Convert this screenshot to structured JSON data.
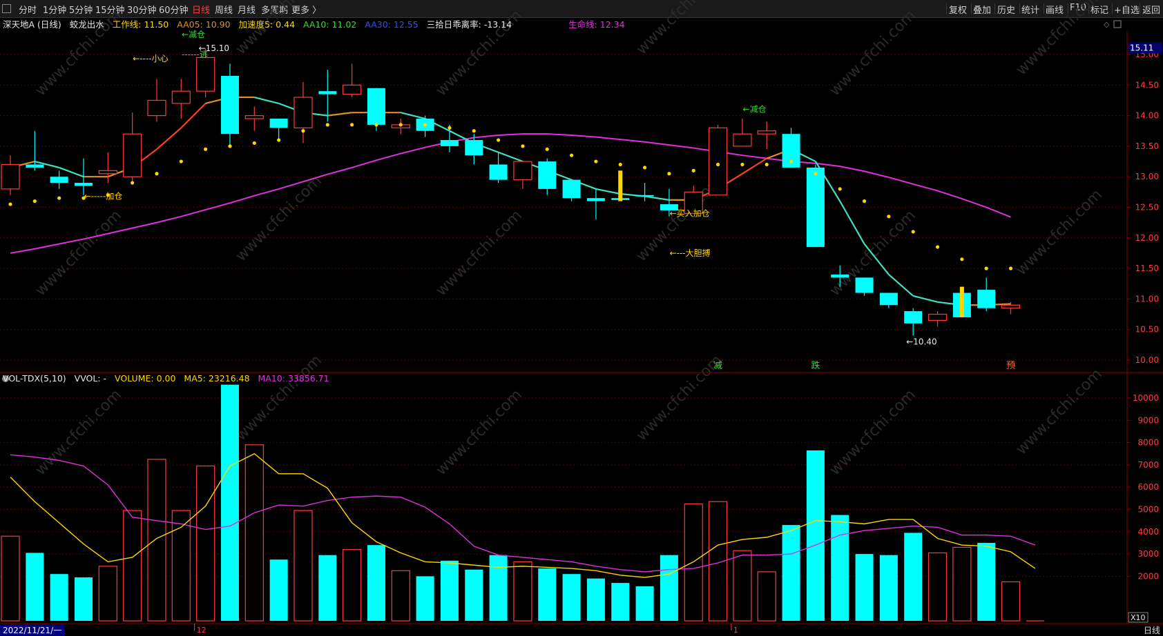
{
  "toolbar": {
    "left_items": [
      "分时",
      "1分钟",
      "5分钟",
      "15分钟",
      "30分钟",
      "60分钟",
      "日线",
      "周线",
      "月线",
      "多周期",
      "更多 〉"
    ],
    "active": "日线",
    "right_items": [
      "复权",
      "叠加",
      "历史",
      "统计",
      "画线",
      "F10",
      "标记",
      "+自选",
      "返回"
    ]
  },
  "main_info": {
    "stock": "深天地A (日线)",
    "indicator": "蛟龙出水",
    "work_line": "工作线: 11.50",
    "aa05": "AA05: 10.90",
    "speed": "加速度5: 0.44",
    "aa10": "AA10: 11.02",
    "aa30": "AA30: 12.55",
    "deviation": "三拾日乖离率: -13.14",
    "life_line": "生命线: 12.34"
  },
  "vol_info": {
    "name": "VOL-TDX(5,10)",
    "vvol": "VVOL: -",
    "volume": "VOLUME: 0.00",
    "ma5": "MA5: 23216.48",
    "ma10": "MA10: 33856.71"
  },
  "footer": {
    "date": "2022/11/21/一",
    "period": "日线",
    "month_labels": [
      "12",
      "1"
    ]
  },
  "watermark": "www.cfchi.com",
  "colors": {
    "up": "#ff3b3b",
    "down": "#00ffff",
    "yellow": "#ffd700",
    "magenta": "#e030e0",
    "green": "#33dd33",
    "cyan_line": "#40e0c0",
    "orange": "#e09020"
  },
  "chart_data": [
    {
      "type": "candlestick",
      "title": "深天地A (日线)",
      "y_ticks": [
        10.0,
        10.5,
        11.0,
        11.5,
        12.0,
        12.5,
        13.0,
        13.5,
        14.0,
        14.5,
        15.0
      ],
      "ylim": [
        9.5,
        15.2
      ],
      "current_price_tag": "15.11",
      "candles": [
        {
          "o": 12.8,
          "c": 13.2,
          "h": 13.35,
          "l": 12.7,
          "u": 1
        },
        {
          "o": 13.2,
          "c": 13.15,
          "h": 13.75,
          "l": 13.1,
          "u": 0
        },
        {
          "o": 13.0,
          "c": 12.9,
          "h": 13.1,
          "l": 12.8,
          "u": 0
        },
        {
          "o": 12.9,
          "c": 12.85,
          "h": 13.3,
          "l": 12.7,
          "u": 0
        },
        {
          "o": 13.05,
          "c": 13.1,
          "h": 13.4,
          "l": 12.9,
          "u": 1
        },
        {
          "o": 13.0,
          "c": 13.7,
          "h": 14.05,
          "l": 12.9,
          "u": 1
        },
        {
          "o": 14.0,
          "c": 14.25,
          "h": 14.6,
          "l": 13.9,
          "u": 1
        },
        {
          "o": 14.2,
          "c": 14.4,
          "h": 14.6,
          "l": 13.95,
          "u": 1
        },
        {
          "o": 14.4,
          "c": 14.95,
          "h": 15.1,
          "l": 14.3,
          "u": 1
        },
        {
          "o": 14.65,
          "c": 13.7,
          "h": 14.85,
          "l": 13.5,
          "u": 0
        },
        {
          "o": 13.95,
          "c": 14.0,
          "h": 14.15,
          "l": 13.75,
          "u": 1
        },
        {
          "o": 13.95,
          "c": 13.8,
          "h": 13.95,
          "l": 13.6,
          "u": 0
        },
        {
          "o": 13.8,
          "c": 14.3,
          "h": 14.55,
          "l": 13.55,
          "u": 1
        },
        {
          "o": 14.4,
          "c": 14.35,
          "h": 14.75,
          "l": 13.9,
          "u": 0
        },
        {
          "o": 14.35,
          "c": 14.5,
          "h": 14.85,
          "l": 14.3,
          "u": 1
        },
        {
          "o": 14.45,
          "c": 13.85,
          "h": 14.45,
          "l": 13.75,
          "u": 0
        },
        {
          "o": 13.8,
          "c": 13.85,
          "h": 13.95,
          "l": 13.7,
          "u": 1
        },
        {
          "o": 13.95,
          "c": 13.75,
          "h": 14.0,
          "l": 13.65,
          "u": 0
        },
        {
          "o": 13.6,
          "c": 13.5,
          "h": 13.85,
          "l": 13.4,
          "u": 0
        },
        {
          "o": 13.6,
          "c": 13.35,
          "h": 13.7,
          "l": 13.2,
          "u": 0
        },
        {
          "o": 13.2,
          "c": 12.95,
          "h": 13.4,
          "l": 12.9,
          "u": 0
        },
        {
          "o": 12.95,
          "c": 13.25,
          "h": 13.25,
          "l": 12.8,
          "u": 1
        },
        {
          "o": 13.25,
          "c": 12.8,
          "h": 13.3,
          "l": 12.7,
          "u": 0
        },
        {
          "o": 12.95,
          "c": 12.65,
          "h": 12.95,
          "l": 12.6,
          "u": 0
        },
        {
          "o": 12.65,
          "c": 12.6,
          "h": 12.8,
          "l": 12.3,
          "u": 0
        },
        {
          "o": 12.65,
          "c": 12.62,
          "h": 13.1,
          "l": 12.6,
          "u": 0,
          "mark": 1
        },
        {
          "o": 12.7,
          "c": 12.68,
          "h": 12.9,
          "l": 12.6,
          "u": 0
        },
        {
          "o": 12.55,
          "c": 12.45,
          "h": 12.8,
          "l": 12.35,
          "u": 0
        },
        {
          "o": 12.4,
          "c": 12.75,
          "h": 12.85,
          "l": 12.4,
          "u": 1
        },
        {
          "o": 12.7,
          "c": 13.8,
          "h": 13.85,
          "l": 12.7,
          "u": 1
        },
        {
          "o": 13.5,
          "c": 13.7,
          "h": 13.95,
          "l": 13.5,
          "u": 1
        },
        {
          "o": 13.7,
          "c": 13.75,
          "h": 13.9,
          "l": 13.45,
          "u": 1
        },
        {
          "o": 13.7,
          "c": 13.15,
          "h": 13.8,
          "l": 13.15,
          "u": 0
        },
        {
          "o": 13.15,
          "c": 11.85,
          "h": 13.2,
          "l": 11.85,
          "u": 0
        },
        {
          "o": 11.4,
          "c": 11.35,
          "h": 11.55,
          "l": 11.2,
          "u": 0
        },
        {
          "o": 11.35,
          "c": 11.1,
          "h": 11.35,
          "l": 11.05,
          "u": 0
        },
        {
          "o": 11.1,
          "c": 10.9,
          "h": 11.1,
          "l": 10.85,
          "u": 0
        },
        {
          "o": 10.8,
          "c": 10.6,
          "h": 10.85,
          "l": 10.4,
          "u": 0
        },
        {
          "o": 10.65,
          "c": 10.75,
          "h": 10.8,
          "l": 10.55,
          "u": 1
        },
        {
          "o": 10.7,
          "c": 11.1,
          "h": 11.2,
          "l": 10.7,
          "u": 1,
          "mark": 1
        },
        {
          "o": 11.15,
          "c": 10.85,
          "h": 11.35,
          "l": 10.8,
          "u": 0
        },
        {
          "o": 10.85,
          "c": 10.9,
          "h": 10.95,
          "l": 10.75,
          "u": 1
        }
      ],
      "short_ma": [
        13.15,
        13.25,
        13.15,
        13.0,
        13.0,
        13.15,
        13.45,
        13.8,
        14.2,
        14.3,
        14.3,
        14.2,
        14.05,
        14.0,
        14.05,
        14.05,
        14.05,
        13.95,
        13.75,
        13.55,
        13.4,
        13.25,
        13.1,
        12.95,
        12.8,
        12.72,
        12.68,
        12.62,
        12.62,
        12.8,
        13.05,
        13.3,
        13.45,
        13.25,
        12.6,
        11.9,
        11.4,
        11.05,
        10.95,
        10.9,
        10.9,
        10.92
      ],
      "life_line": [
        11.75,
        11.82,
        11.9,
        11.98,
        12.07,
        12.16,
        12.25,
        12.35,
        12.46,
        12.57,
        12.69,
        12.8,
        12.92,
        13.04,
        13.15,
        13.27,
        13.38,
        13.48,
        13.57,
        13.64,
        13.68,
        13.7,
        13.7,
        13.68,
        13.65,
        13.61,
        13.57,
        13.52,
        13.47,
        13.41,
        13.35,
        13.3,
        13.25,
        13.22,
        13.17,
        13.09,
        12.99,
        12.88,
        12.77,
        12.64,
        12.5,
        12.34
      ],
      "dots": [
        12.55,
        12.6,
        12.65,
        12.65,
        12.7,
        12.9,
        13.05,
        13.25,
        13.45,
        13.5,
        13.55,
        13.6,
        13.75,
        13.85,
        13.85,
        13.85,
        13.85,
        13.85,
        13.8,
        13.75,
        13.6,
        13.5,
        13.45,
        13.35,
        13.25,
        13.2,
        13.15,
        13.05,
        13.1,
        13.2,
        13.2,
        13.2,
        13.25,
        13.05,
        12.8,
        12.6,
        12.35,
        12.1,
        11.85,
        11.65,
        11.5,
        11.5
      ],
      "annotations": [
        {
          "text": "←----小心",
          "i": 7,
          "p": 14.93,
          "c": "y"
        },
        {
          "text": "←15.10",
          "i": 8,
          "p": 15.1,
          "c": "w"
        },
        {
          "text": "←减仓",
          "i": 9,
          "p": 15.33,
          "c": "g"
        },
        {
          "text": "------逃",
          "i": 9,
          "p": 15.0,
          "c": "g"
        },
        {
          "text": "←-----加仓",
          "i": 5,
          "p": 12.68,
          "c": "y"
        },
        {
          "text": "←减仓",
          "i": 32,
          "p": 14.1,
          "c": "g"
        },
        {
          "text": "←买入加仓",
          "i": 29,
          "p": 12.4,
          "c": "y"
        },
        {
          "text": "←---大胆搏",
          "i": 29,
          "p": 11.75,
          "c": "y"
        },
        {
          "text": "←10.40",
          "i": 37,
          "p": 10.3,
          "c": "w"
        }
      ],
      "signals": [
        {
          "text": "减",
          "i": 29,
          "c": "g"
        },
        {
          "text": "跌",
          "i": 33,
          "c": "g"
        },
        {
          "text": "预",
          "i": 41,
          "c": "r"
        }
      ]
    },
    {
      "type": "bar",
      "title": "VOL-TDX(5,10)",
      "y_ticks": [
        2000,
        3000,
        4000,
        5000,
        6000,
        7000,
        8000,
        9000,
        10000
      ],
      "ylim": [
        0,
        10700
      ],
      "unit_tag": "X10",
      "volumes": [
        3800,
        3050,
        2100,
        1950,
        2450,
        4950,
        7250,
        4950,
        6950,
        10600,
        7900,
        2750,
        4950,
        2950,
        3200,
        3400,
        2250,
        2000,
        2700,
        2300,
        2950,
        2650,
        2350,
        2100,
        1900,
        1700,
        1550,
        2950,
        5250,
        5350,
        3150,
        2200,
        4300,
        7650,
        4750,
        3000,
        2950,
        3950,
        3050,
        3300,
        3500,
        1750,
        0
      ],
      "ma5": [
        6450,
        5350,
        4400,
        3450,
        2650,
        2850,
        3700,
        4200,
        5150,
        6950,
        7500,
        6600,
        6600,
        5950,
        4400,
        3550,
        3050,
        2650,
        2600,
        2500,
        2400,
        2450,
        2400,
        2350,
        2250,
        2050,
        1950,
        2100,
        2650,
        3400,
        3650,
        3750,
        4050,
        4500,
        4450,
        4350,
        4550,
        4550,
        3700,
        3400,
        3350,
        3100,
        2350
      ],
      "ma10": [
        7450,
        7350,
        7200,
        6950,
        6100,
        4650,
        4500,
        4350,
        4100,
        4250,
        4850,
        5200,
        5150,
        5400,
        5550,
        5600,
        5550,
        5100,
        4350,
        3350,
        2950,
        2850,
        2750,
        2650,
        2450,
        2300,
        2200,
        2300,
        2350,
        2600,
        2950,
        2950,
        3000,
        3400,
        3850,
        4050,
        4150,
        4250,
        4200,
        3850,
        3850,
        3800,
        3400
      ]
    }
  ]
}
